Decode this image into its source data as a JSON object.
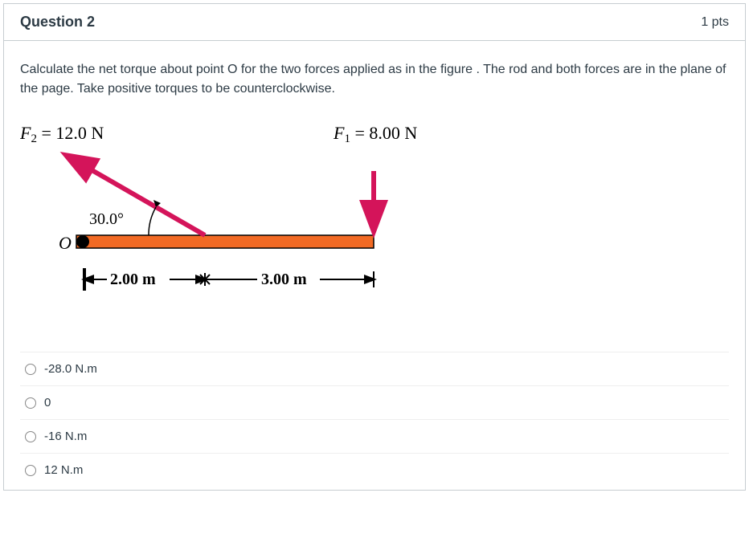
{
  "header": {
    "title": "Question 2",
    "points": "1 pts"
  },
  "prompt": "Calculate the net torque about point O for the two forces applied as in the figure . The rod and both forces are in the plane of the page. Take positive torques to be counterclockwise.",
  "figure": {
    "f2_label": "F₂ = 12.0 N",
    "f1_label": "F₁ = 8.00 N",
    "angle": "30.0°",
    "origin": "O",
    "dim1": "2.00 m",
    "dim2": "3.00 m"
  },
  "answers": [
    {
      "label": "-28.0 N.m"
    },
    {
      "label": "0"
    },
    {
      "label": "-16 N.m"
    },
    {
      "label": "12 N.m"
    }
  ]
}
